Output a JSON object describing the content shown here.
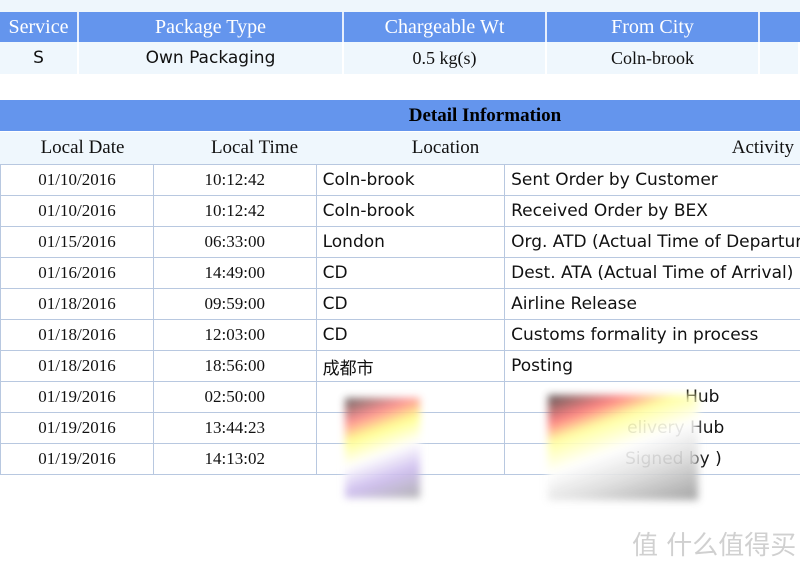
{
  "summary": {
    "headers": [
      "Service",
      "Package Type",
      "Chargeable Wt",
      "From City"
    ],
    "values": [
      "S",
      "Own Packaging",
      "0.5 kg(s)",
      "Coln-brook"
    ]
  },
  "detail": {
    "title": "Detail Information",
    "columns": [
      "Local Date",
      "Local Time",
      "Location",
      "Activity"
    ],
    "rows": [
      {
        "date": "01/10/2016",
        "time": "10:12:42",
        "location": "Coln-brook",
        "activity": "Sent Order by Customer"
      },
      {
        "date": "01/10/2016",
        "time": "10:12:42",
        "location": "Coln-brook",
        "activity": "Received Order by BEX"
      },
      {
        "date": "01/15/2016",
        "time": "06:33:00",
        "location": "London",
        "activity": "Org. ATD (Actual Time of Departure)"
      },
      {
        "date": "01/16/2016",
        "time": "14:49:00",
        "location": "CD",
        "activity": "Dest. ATA (Actual Time of Arrival)"
      },
      {
        "date": "01/18/2016",
        "time": "09:59:00",
        "location": "CD",
        "activity": "Airline Release"
      },
      {
        "date": "01/18/2016",
        "time": "12:03:00",
        "location": "CD",
        "activity": "Customs formality in process"
      },
      {
        "date": "01/18/2016",
        "time": "18:56:00",
        "location": "成都市",
        "activity": "Posting"
      },
      {
        "date": "01/19/2016",
        "time": "02:50:00",
        "location": "",
        "activity": "Hub"
      },
      {
        "date": "01/19/2016",
        "time": "13:44:23",
        "location": "",
        "activity": "elivery Hub"
      },
      {
        "date": "01/19/2016",
        "time": "14:13:02",
        "location": "",
        "activity": "Signed by )"
      }
    ]
  },
  "watermark": "值 什么值得买"
}
